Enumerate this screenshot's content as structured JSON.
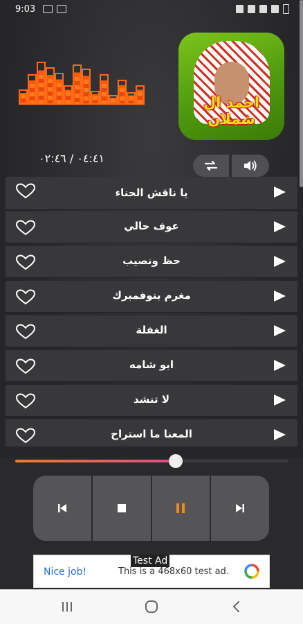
{
  "status_bar": {
    "time": "9:03"
  },
  "player": {
    "time_display": "٠٤:٤١ / ٠٢:٤٦",
    "album_caption": "احمد ال شملان",
    "progress_fraction": 0.59,
    "accent_colors": {
      "orange": "#ff6a1a",
      "pink": "#e24a8a",
      "pause": "#f08a1a"
    }
  },
  "buttons": {
    "repeat_icon": "repeat-icon",
    "volume_icon": "volume-icon"
  },
  "playlist": {
    "tracks": [
      {
        "title": "يا ناقش الحناء"
      },
      {
        "title": "عوف حالي"
      },
      {
        "title": "حظ ونصيب"
      },
      {
        "title": "مغرم بنوفمبرك"
      },
      {
        "title": "الغفلة"
      },
      {
        "title": "ابو شامه"
      },
      {
        "title": "لا تنشد"
      },
      {
        "title": "المعنا ما استراح"
      }
    ]
  },
  "controls": [
    "previous-icon",
    "stop-icon",
    "pause-icon",
    "next-icon"
  ],
  "ad": {
    "label": "Test Ad",
    "nice": "Nice job!",
    "text": "This is a 468x60 test ad."
  }
}
